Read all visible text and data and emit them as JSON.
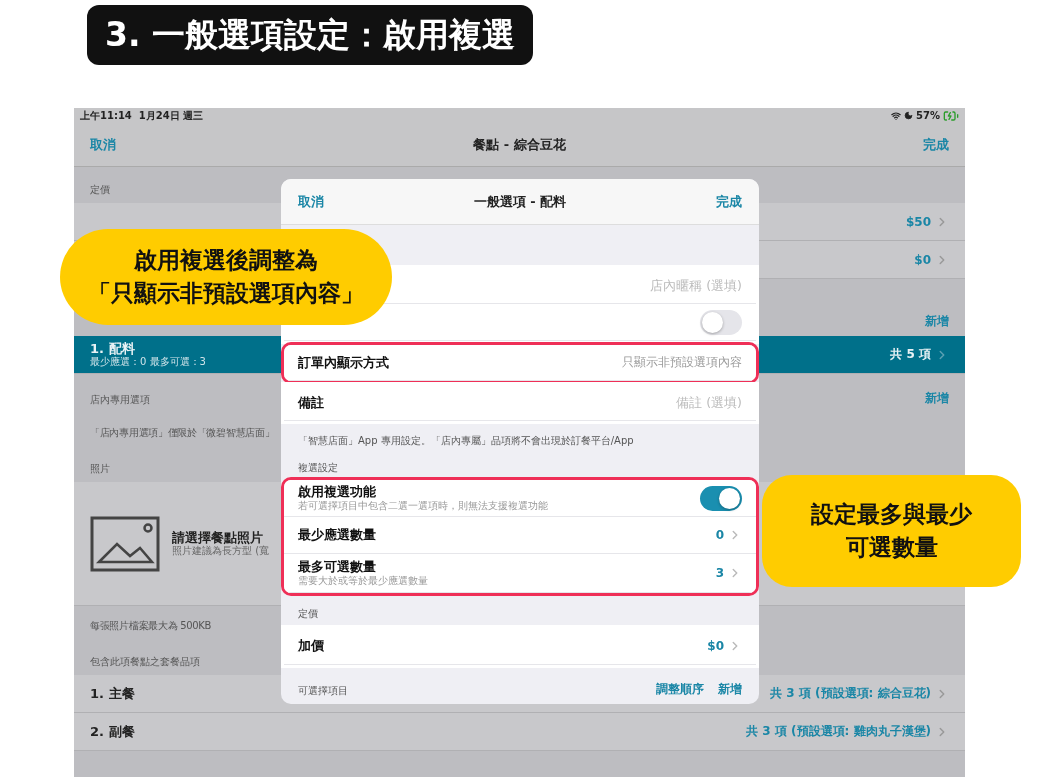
{
  "title_badge": "3. 一般選項設定：啟用複選",
  "status_bar": {
    "time": "上午11:14",
    "date": "1月24日 週三",
    "battery": "57%"
  },
  "nav": {
    "cancel": "取消",
    "title": "餐點 - 綜合豆花",
    "done": "完成"
  },
  "sections": [
    {
      "header": "定價",
      "rows": [
        {
          "kind": "value",
          "value": "$50",
          "selected": false
        },
        {
          "kind": "value",
          "value": "$0",
          "selected": false
        }
      ]
    },
    {
      "action": "新增",
      "rows": [
        {
          "kind": "value",
          "label": "1. 配料",
          "subtitle": "最少應選：0 最多可選：3",
          "value": "共 5 項",
          "selected": true
        }
      ]
    },
    {
      "header": "店內專用選項",
      "action": "新增",
      "footer": "「店內專用選項」僅限於「微碧智慧店面」"
    },
    {
      "header": "照片",
      "rows": [
        {
          "kind": "photo",
          "label": "請選擇餐點照片",
          "subtitle": "照片建議為長方型 (寬",
          "selected": false
        }
      ],
      "footer": "每張照片檔案最大為 500KB"
    },
    {
      "header": "包含此項餐點之套餐品項",
      "rows": [
        {
          "kind": "value",
          "label": "1. 主餐",
          "value": "共 3 項 (預設選項: 綜合豆花)",
          "selected": false
        },
        {
          "kind": "value",
          "label": "2. 副餐",
          "value": "共 3 項 (預設選項: 雞肉丸子漢堡)",
          "selected": false
        }
      ]
    }
  ],
  "modal": {
    "cancel": "取消",
    "title": "一般選項 - 配料",
    "done": "完成",
    "sections": [
      {
        "groups": [
          {
            "highlighted": false,
            "rows": [
              {
                "kind": "field",
                "placeholder": "店內暱稱 (選填)"
              },
              {
                "kind": "toggle",
                "on": false
              }
            ]
          },
          {
            "highlighted": true,
            "rows": [
              {
                "kind": "choice",
                "label": "訂單內顯示方式",
                "value": "只顯示非預設選項內容"
              }
            ]
          },
          {
            "highlighted": false,
            "rows": [
              {
                "kind": "field",
                "label": "備註",
                "placeholder": "備註 (選填)"
              }
            ]
          }
        ],
        "footer": "「智慧店面」App 專用設定。「店內專屬」品項將不會出現於訂餐平台/App"
      },
      {
        "header": "複選設定",
        "groups": [
          {
            "highlighted": true,
            "rows": [
              {
                "kind": "toggle",
                "label": "啟用複選功能",
                "subtitle": "若可選擇項目中包含二選一選項時，則無法支援複選功能",
                "on": true
              },
              {
                "kind": "link",
                "label": "最少應選數量",
                "value": "0"
              },
              {
                "kind": "link",
                "label": "最多可選數量",
                "subtitle": "需要大於或等於最少應選數量",
                "value": "3"
              }
            ]
          }
        ]
      },
      {
        "header": "定價",
        "groups": [
          {
            "highlighted": false,
            "rows": [
              {
                "kind": "link",
                "label": "加價",
                "value": "$0"
              }
            ]
          }
        ]
      },
      {
        "header": "可選擇項目",
        "actions": [
          "調整順序",
          "新增"
        ]
      }
    ]
  },
  "callouts": [
    {
      "lines": [
        "啟用複選後調整為",
        "「只顯示非預設選項內容」"
      ]
    },
    {
      "lines": [
        "設定最多與最少",
        "可選數量"
      ]
    }
  ]
}
